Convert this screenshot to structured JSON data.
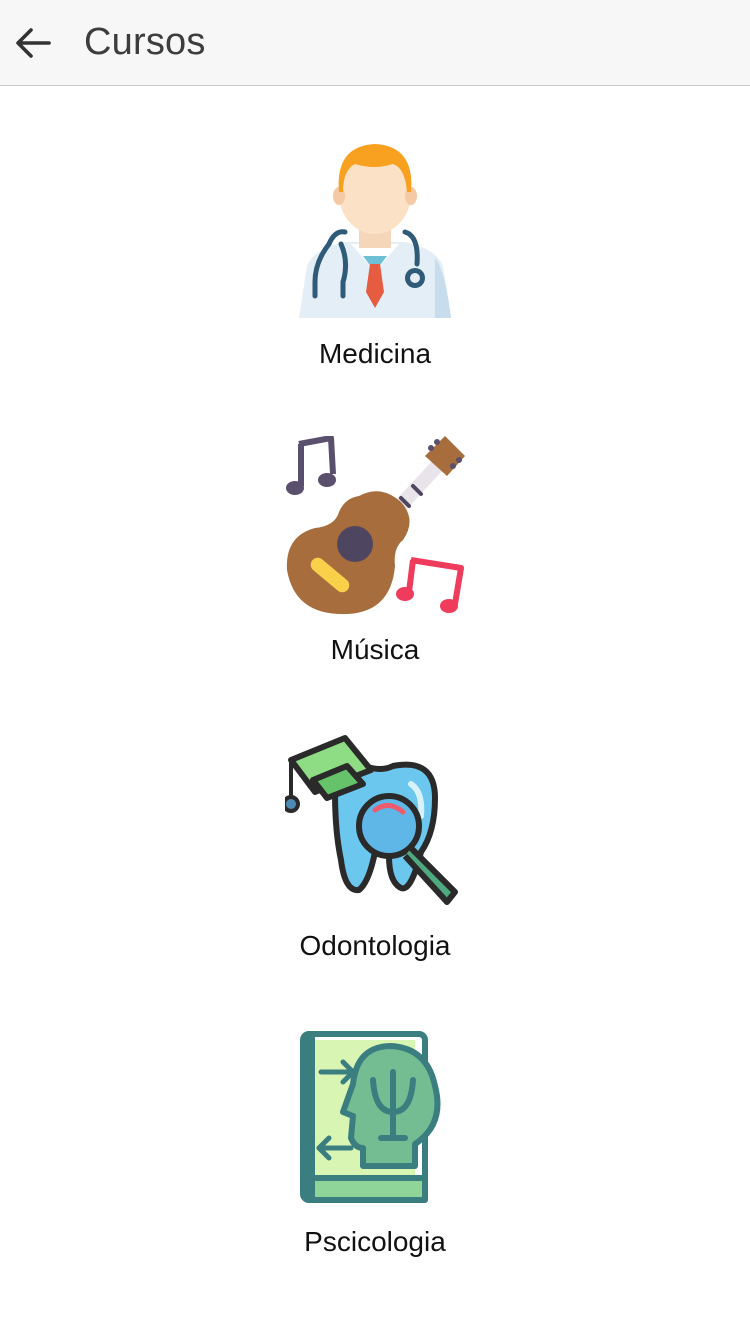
{
  "header": {
    "title": "Cursos",
    "back_icon": "arrow-left-icon"
  },
  "courses": [
    {
      "label": "Medicina",
      "icon": "doctor-icon"
    },
    {
      "label": "Música",
      "icon": "guitar-music-icon"
    },
    {
      "label": "Odontologia",
      "icon": "tooth-graduation-icon"
    },
    {
      "label": "Pscicologia",
      "icon": "psychology-book-icon"
    }
  ],
  "colors": {
    "appbar_bg": "#f7f7f7",
    "title": "#3d3d3d",
    "label": "#111111"
  }
}
